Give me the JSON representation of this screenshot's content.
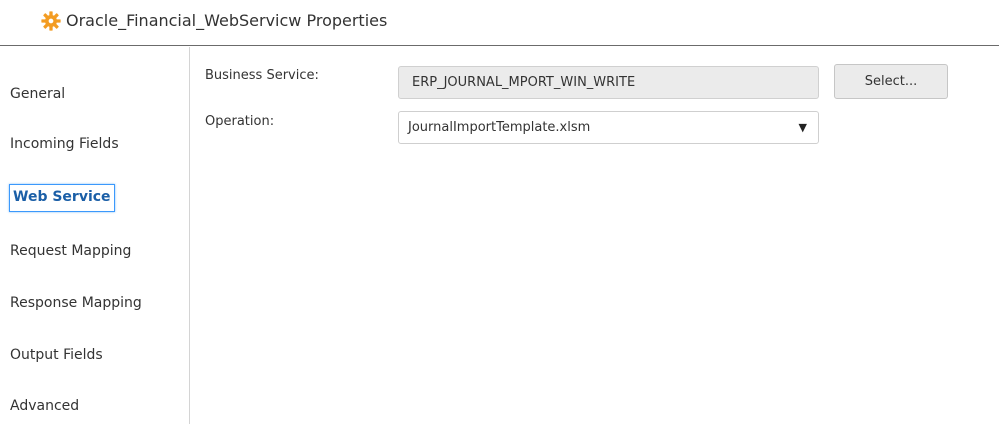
{
  "header": {
    "icon": "gear-icon",
    "icon_color": "#f39c22",
    "title": "Oracle_Financial_WebServicw Properties"
  },
  "nav": {
    "items": [
      {
        "label": "General",
        "active": false
      },
      {
        "label": "Incoming Fields",
        "active": false
      },
      {
        "label": "Web Service",
        "active": true
      },
      {
        "label": "Request Mapping",
        "active": false
      },
      {
        "label": "Response Mapping",
        "active": false
      },
      {
        "label": "Output Fields",
        "active": false
      },
      {
        "label": "Advanced",
        "active": false
      }
    ]
  },
  "form": {
    "business_service": {
      "label": "Business Service:",
      "value": "ERP_JOURNAL_MPORT_WIN_WRITE",
      "button_label": "Select..."
    },
    "operation": {
      "label": "Operation:",
      "selected": "JournalImportTemplate.xlsm",
      "arrow_icon": "caret-down-icon"
    }
  },
  "colors": {
    "active_border": "#3b99fc",
    "active_text": "#1b5fa7",
    "field_background": "#ebebeb"
  }
}
